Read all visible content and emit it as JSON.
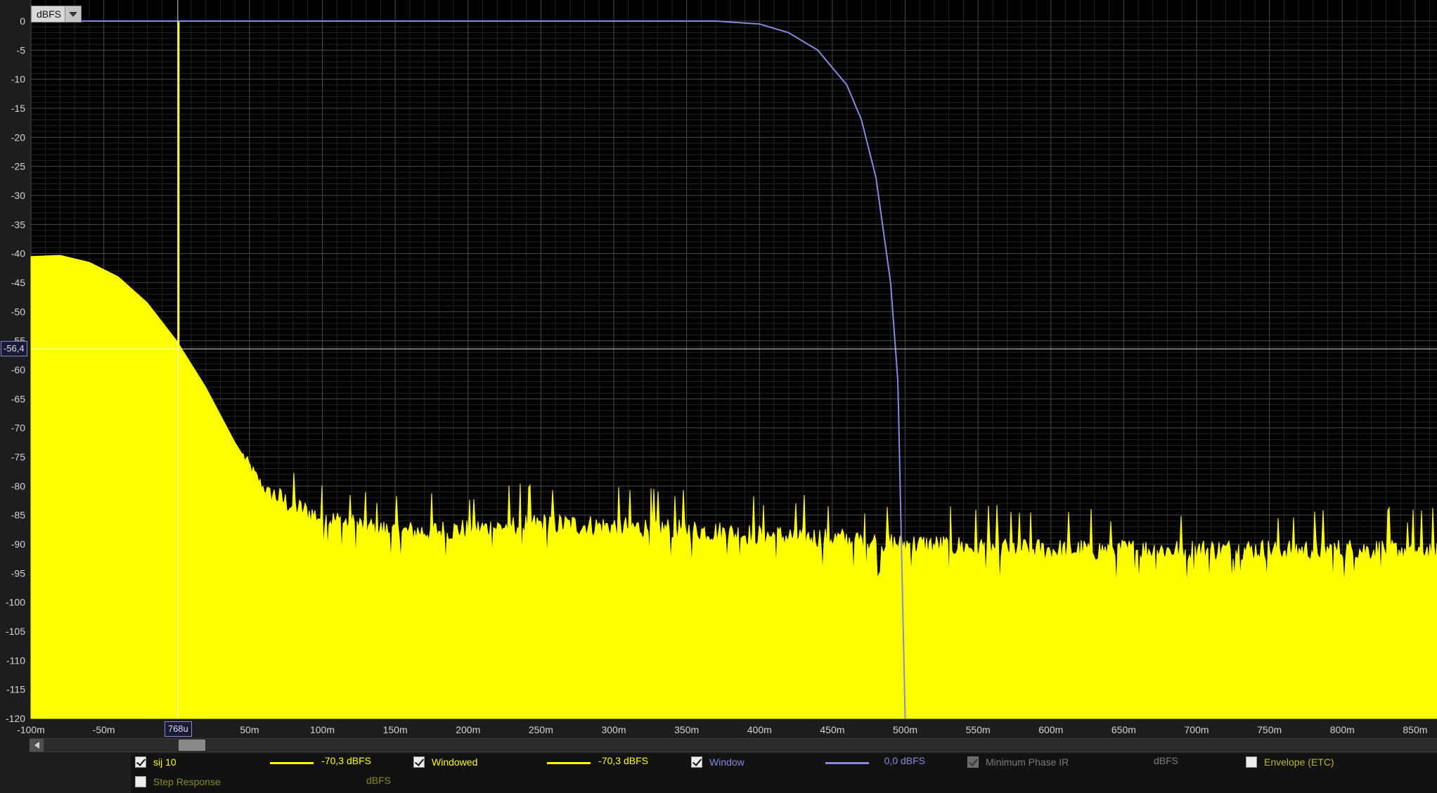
{
  "unit_selector": {
    "label": "dBFS"
  },
  "cursor": {
    "y_readout": "-56,4",
    "x_readout": "768u"
  },
  "colors": {
    "background": "#000000",
    "grid_major": "#4a4a4a",
    "grid_minor": "#242424",
    "ir_trace": "#ffff00",
    "window_trace": "#8888e0",
    "cursor_line": "#ffffff"
  },
  "legend": {
    "items": [
      {
        "label": "sij 10",
        "checked": true,
        "color": "#ffff00",
        "value": "-70,3 dBFS"
      },
      {
        "label": "Windowed",
        "checked": true,
        "color": "#ffff00",
        "value": "-70,3 dBFS"
      },
      {
        "label": "Window",
        "checked": true,
        "color": "#8888e0",
        "value": "0,0 dBFS"
      },
      {
        "label": "Minimum Phase IR",
        "checked": true,
        "disabled": true,
        "unit": "dBFS"
      },
      {
        "label": "Envelope (ETC)",
        "checked": false
      },
      {
        "label": "Step Response",
        "checked": false,
        "unit": "dBFS"
      }
    ]
  },
  "chart_data": {
    "type": "area",
    "ylim": [
      -120,
      0
    ],
    "xlim": [
      -0.1,
      0.865
    ],
    "y_ticks": [
      0,
      -5,
      -10,
      -15,
      -20,
      -25,
      -30,
      -35,
      -40,
      -45,
      -50,
      -55,
      -60,
      -65,
      -70,
      -75,
      -80,
      -85,
      -90,
      -95,
      -100,
      -105,
      -110,
      -115,
      -120
    ],
    "y_tick_labels": [
      "0",
      "-5",
      "-10",
      "-15",
      "-20",
      "-25",
      "-30",
      "-35",
      "-40",
      "-45",
      "-50",
      "-55",
      "-60",
      "-65",
      "-70",
      "-75",
      "-80",
      "-85",
      "-90",
      "-95",
      "-100",
      "-105",
      "-110",
      "-115",
      "-120"
    ],
    "x_ticks": [
      -0.1,
      -0.05,
      0.05,
      0.1,
      0.15,
      0.2,
      0.25,
      0.3,
      0.35,
      0.4,
      0.45,
      0.5,
      0.55,
      0.6,
      0.65,
      0.7,
      0.75,
      0.8,
      0.85
    ],
    "x_tick_labels": [
      "-100m",
      "-50m",
      "50m",
      "100m",
      "150m",
      "200m",
      "250m",
      "300m",
      "350m",
      "400m",
      "450m",
      "500m",
      "550m",
      "600m",
      "650m",
      "700m",
      "750m",
      "800m",
      "850m"
    ],
    "series": [
      {
        "name": "sij 10",
        "x": [
          -0.1,
          -0.08,
          -0.06,
          -0.04,
          -0.02,
          0.0,
          0.02,
          0.04,
          0.06,
          0.08,
          0.1,
          0.15,
          0.2,
          0.25,
          0.3,
          0.35,
          0.4,
          0.45,
          0.5,
          0.55,
          0.6,
          0.65,
          0.7,
          0.75,
          0.8,
          0.865
        ],
        "y": [
          -40.5,
          -40.3,
          -41.5,
          -44.0,
          -48.5,
          -55.0,
          -63.0,
          -72.5,
          -80.5,
          -83.5,
          -85.5,
          -88.0,
          -87.5,
          -86.5,
          -87.0,
          -87.5,
          -88.5,
          -89.0,
          -90.0,
          -90.5,
          -91.0,
          -91.0,
          -91.0,
          -91.0,
          -91.0,
          -91.0
        ],
        "impulse_peak": {
          "x": 0.00077,
          "y": 0
        },
        "noise_floor_db": -91
      },
      {
        "name": "Window",
        "x": [
          -0.1,
          0.3,
          0.37,
          0.4,
          0.42,
          0.44,
          0.46,
          0.47,
          0.48,
          0.49,
          0.495,
          0.5
        ],
        "y": [
          0,
          0,
          0,
          -0.5,
          -2.0,
          -5.0,
          -11.0,
          -17.0,
          -27.0,
          -45.0,
          -62.0,
          -120.0
        ]
      }
    ],
    "cursor": {
      "x": 0.00077,
      "y": -56.4
    }
  }
}
